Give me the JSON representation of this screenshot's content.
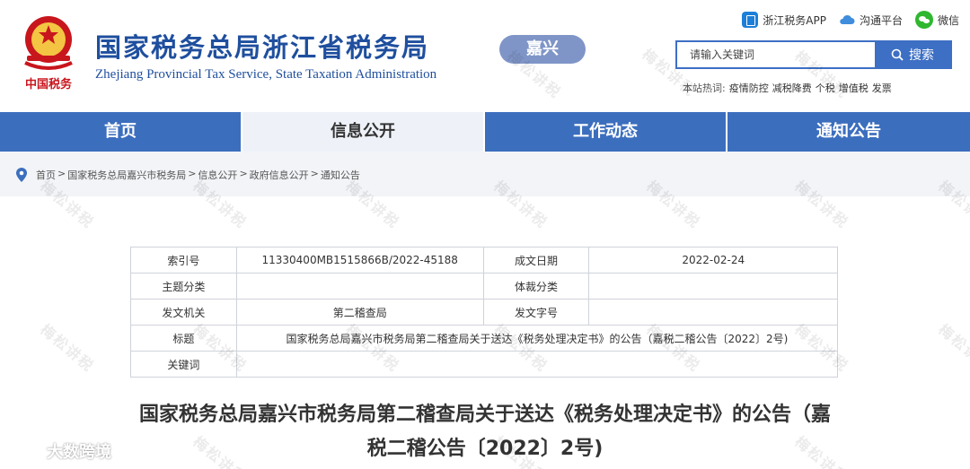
{
  "header": {
    "title": "国家税务总局浙江省税务局",
    "subtitle": "Zhejiang Provincial Tax Service, State Taxation Administration",
    "city_badge": "嘉兴",
    "emblem_caption": "中国税务"
  },
  "top_links": {
    "app": "浙江税务APP",
    "platform": "沟通平台",
    "wechat": "微信"
  },
  "search": {
    "placeholder": "请输入关键词",
    "button_label": "搜索"
  },
  "hot_words": {
    "label": "本站热词:",
    "items": [
      "疫情防控",
      "减税降费",
      "个税",
      "增值税",
      "发票"
    ]
  },
  "nav": {
    "items": [
      {
        "label": "首页"
      },
      {
        "label": "信息公开"
      },
      {
        "label": "工作动态"
      },
      {
        "label": "通知公告"
      }
    ]
  },
  "breadcrumb": {
    "items": [
      "首页",
      "国家税务总局嘉兴市税务局",
      "信息公开",
      "政府信息公开",
      "通知公告"
    ],
    "separator": ">"
  },
  "info_table": {
    "index_no_label": "索引号",
    "index_no": "11330400MB1515866B/2022-45188",
    "date_label": "成文日期",
    "date": "2022-02-24",
    "topic_label": "主题分类",
    "topic": "",
    "genre_label": "体裁分类",
    "genre": "",
    "issuer_label": "发文机关",
    "issuer": "第二稽查局",
    "doc_no_label": "发文字号",
    "doc_no": "",
    "subject_label": "标题",
    "subject": "国家税务总局嘉兴市税务局第二稽查局关于送达《税务处理决定书》的公告（嘉税二稽公告〔2022〕2号)",
    "keywords_label": "关键词",
    "keywords": ""
  },
  "article": {
    "title_line1": "国家税务总局嘉兴市税务局第二稽查局关于送达《税务处理决定书》的公告（嘉",
    "title_line2": "税二稽公告〔2022〕2号)"
  },
  "watermark": {
    "text": "梅松讲税",
    "corner_brand": "大数跨境"
  },
  "colors": {
    "brand_blue": "#1f4f9e",
    "nav_blue": "#3c6ebe",
    "badge": "#7f95c7",
    "emblem_red": "#c8161d"
  }
}
